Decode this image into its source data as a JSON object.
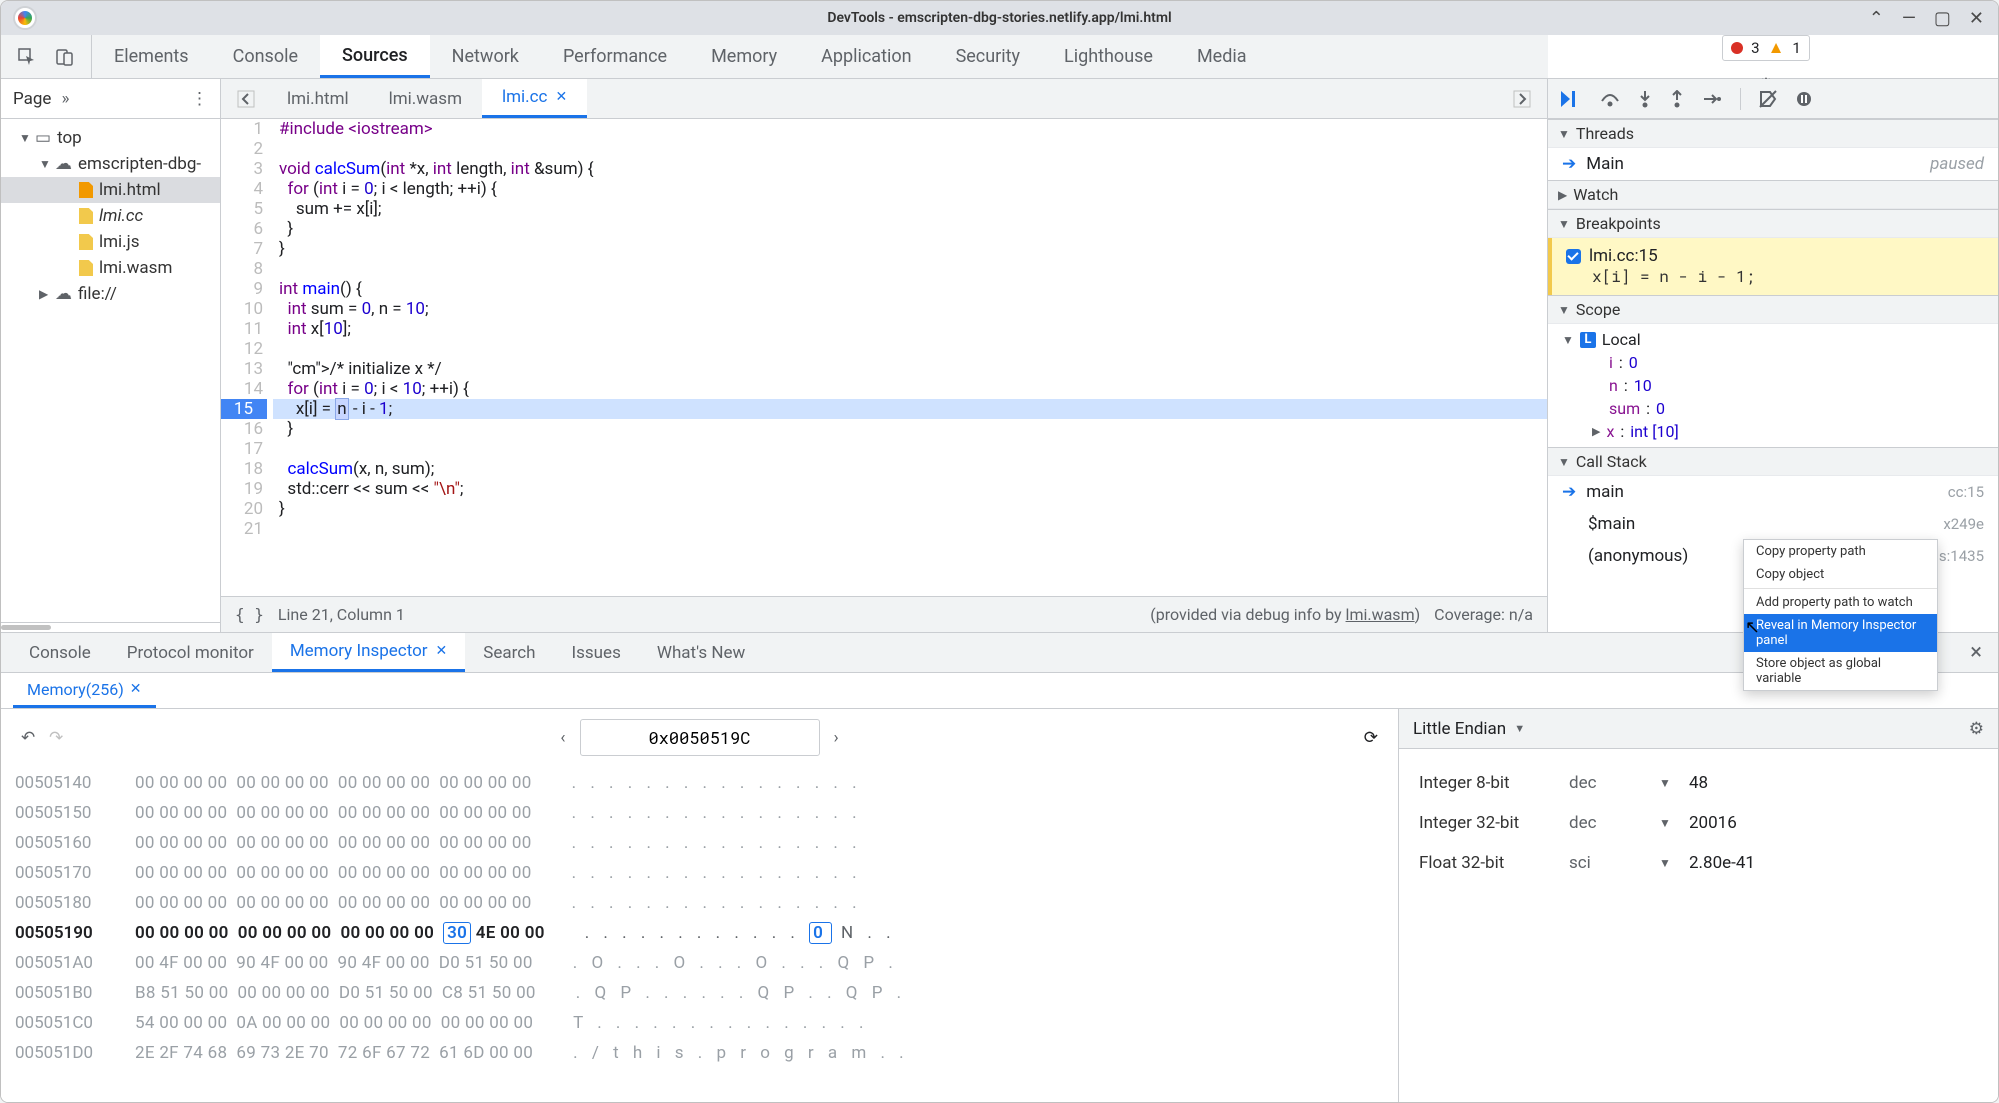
{
  "window": {
    "title": "DevTools - emscripten-dbg-stories.netlify.app/lmi.html"
  },
  "main_tabs": [
    "Elements",
    "Console",
    "Sources",
    "Network",
    "Performance",
    "Memory",
    "Application",
    "Security",
    "Lighthouse",
    "Media"
  ],
  "main_active": "Sources",
  "issue_badge": {
    "errors": 3,
    "warnings": 1
  },
  "nav": {
    "head": "Page",
    "tree": [
      {
        "d": 1,
        "tw": "▼",
        "icon": "window",
        "label": "top"
      },
      {
        "d": 2,
        "tw": "▼",
        "icon": "cloud",
        "label": "emscripten-dbg-"
      },
      {
        "d": 3,
        "icon": "html",
        "label": "lmi.html",
        "sel": true
      },
      {
        "d": 3,
        "icon": "cc",
        "label": "lmi.cc",
        "italic": true
      },
      {
        "d": 3,
        "icon": "js",
        "label": "lmi.js"
      },
      {
        "d": 3,
        "icon": "wasm",
        "label": "lmi.wasm"
      },
      {
        "d": 2,
        "tw": "▶",
        "icon": "cloud",
        "label": "file://"
      }
    ]
  },
  "file_tabs": [
    "lmi.html",
    "lmi.wasm",
    "lmi.cc"
  ],
  "file_active": "lmi.cc",
  "source": {
    "lines": [
      "#include <iostream>",
      "",
      "void calcSum(int *x, int length, int &sum) {",
      "  for (int i = 0; i < length; ++i) {",
      "    sum += x[i];",
      "  }",
      "}",
      "",
      "int main() {",
      "  int sum = 0, n = 10;",
      "  int x[10];",
      "",
      "  /* initialize x */",
      "  for (int i = 0; i < 10; ++i) {",
      "    x[i] = n - i - 1;",
      "  }",
      "",
      "  calcSum(x, n, sum);",
      "  std::cerr << sum << \"\\n\";",
      "}",
      ""
    ],
    "bp_line": 15
  },
  "status": {
    "cursor": "Line 21, Column 1",
    "debug_info": "(provided via debug info by ",
    "debug_link": "lmi.wasm",
    "coverage": "Coverage: n/a"
  },
  "debugger": {
    "threads_title": "Threads",
    "thread": {
      "name": "Main",
      "status": "paused"
    },
    "watch_title": "Watch",
    "breakpoints_title": "Breakpoints",
    "bp": {
      "file": "lmi.cc:15",
      "code": "x[i] = n - i - 1;"
    },
    "scope_title": "Scope",
    "scope_local": "Local",
    "scope_vars": [
      {
        "k": "i",
        "v": "0"
      },
      {
        "k": "n",
        "v": "10"
      },
      {
        "k": "sum",
        "v": "0"
      },
      {
        "k": "x",
        "v": "int [10]",
        "expandable": true
      }
    ],
    "callstack_title": "Call Stack",
    "frames": [
      {
        "name": "main",
        "loc": "cc:15",
        "current": true
      },
      {
        "name": "$main",
        "loc": "x249e"
      },
      {
        "name": "(anonymous)",
        "loc": "lmi.js:1435"
      }
    ]
  },
  "context_menu": {
    "items": [
      "Copy property path",
      "Copy object",
      "Add property path to watch",
      "Reveal in Memory Inspector panel",
      "Store object as global variable"
    ],
    "active": "Reveal in Memory Inspector panel"
  },
  "drawer": {
    "tabs": [
      "Console",
      "Protocol monitor",
      "Memory Inspector",
      "Search",
      "Issues",
      "What's New"
    ],
    "active": "Memory Inspector",
    "mi_tab": "Memory(256)",
    "address": "0x0050519C",
    "endian": "Little Endian",
    "hex_rows": [
      {
        "addr": "00505140",
        "b": "00 00 00 00  00 00 00 00  00 00 00 00  00 00 00 00",
        "a": ". . . . . . . . . . . . . . . ."
      },
      {
        "addr": "00505150",
        "b": "00 00 00 00  00 00 00 00  00 00 00 00  00 00 00 00",
        "a": ". . . . . . . . . . . . . . . ."
      },
      {
        "addr": "00505160",
        "b": "00 00 00 00  00 00 00 00  00 00 00 00  00 00 00 00",
        "a": ". . . . . . . . . . . . . . . ."
      },
      {
        "addr": "00505170",
        "b": "00 00 00 00  00 00 00 00  00 00 00 00  00 00 00 00",
        "a": ". . . . . . . . . . . . . . . ."
      },
      {
        "addr": "00505180",
        "b": "00 00 00 00  00 00 00 00  00 00 00 00  00 00 00 00",
        "a": ". . . . . . . . . . . . . . . ."
      },
      {
        "addr": "00505190",
        "b": "00 00 00 00  00 00 00 00  00 00 00 00  30 4E 00 00",
        "a": ". . . . . . . . . . . . 0 N . .",
        "active": true,
        "sel_byte": 12,
        "sel_ascii": 12
      },
      {
        "addr": "005051A0",
        "b": "00 4F 00 00  90 4F 00 00  90 4F 00 00  D0 51 50 00",
        "a": ". O . . . O . . . O . . . Q P ."
      },
      {
        "addr": "005051B0",
        "b": "B8 51 50 00  00 00 00 00  D0 51 50 00  C8 51 50 00",
        "a": ". Q P . . . . . . Q P . . Q P ."
      },
      {
        "addr": "005051C0",
        "b": "54 00 00 00  0A 00 00 00  00 00 00 00  00 00 00 00",
        "a": "T . . . . . . . . . . . . . . ."
      },
      {
        "addr": "005051D0",
        "b": "2E 2F 74 68  69 73 2E 70  72 6F 67 72  61 6D 00 00",
        "a": ". / t h i s . p r o g r a m . ."
      }
    ],
    "values": [
      {
        "k": "Integer 8-bit",
        "f": "dec",
        "v": "48"
      },
      {
        "k": "Integer 32-bit",
        "f": "dec",
        "v": "20016"
      },
      {
        "k": "Float 32-bit",
        "f": "sci",
        "v": "2.80e-41"
      }
    ]
  }
}
